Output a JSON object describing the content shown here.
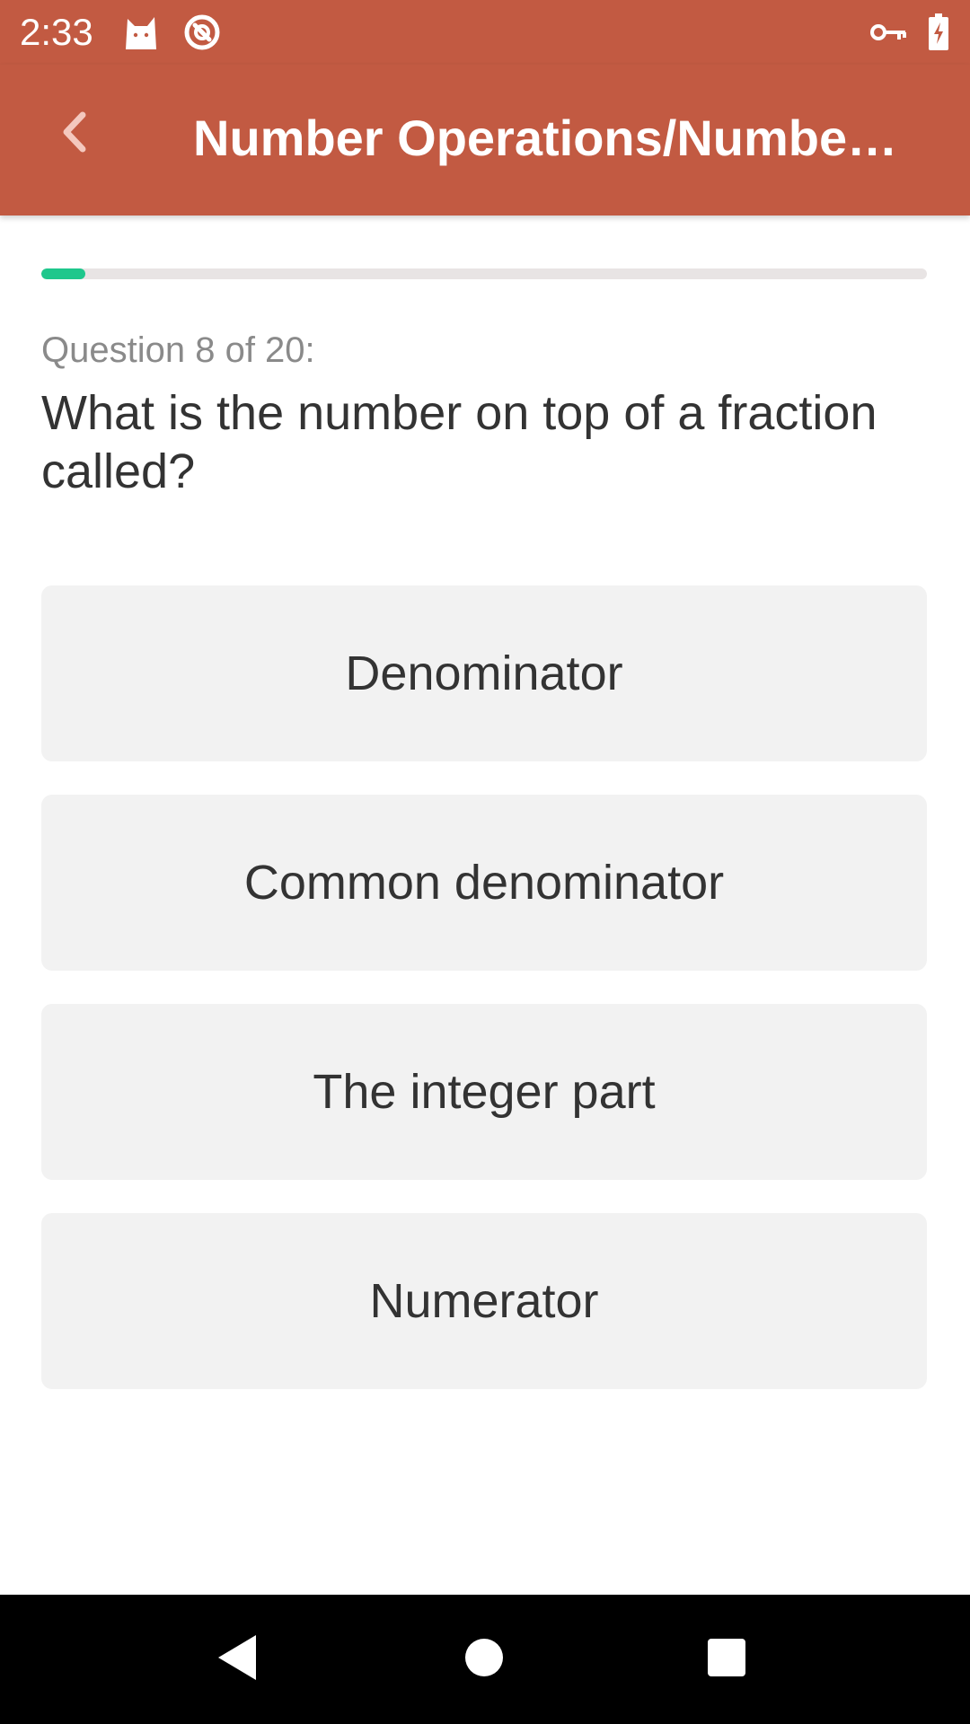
{
  "status_bar": {
    "time": "2:33",
    "icons": [
      "cat-icon",
      "do-not-disturb-icon",
      "vpn-key-icon",
      "battery-charging-icon"
    ]
  },
  "app_bar": {
    "title": "Number Operations/Numbe…",
    "back_icon": "chevron-left-icon"
  },
  "progress": {
    "fraction": 0.05
  },
  "question": {
    "counter": "Question 8 of 20:",
    "text": "What is the number on top of a fraction called?"
  },
  "answers": [
    {
      "label": "Denominator"
    },
    {
      "label": "Common denominator"
    },
    {
      "label": "The integer part"
    },
    {
      "label": "Numerator"
    }
  ],
  "nav_bar": {
    "icons": [
      "back-triangle-icon",
      "home-circle-icon",
      "recents-square-icon"
    ]
  },
  "colors": {
    "primary": "#C25A42",
    "progress": "#1EC78C",
    "answer_bg": "#F2F2F2",
    "text": "#333333",
    "muted_text": "#8A8A8A"
  }
}
